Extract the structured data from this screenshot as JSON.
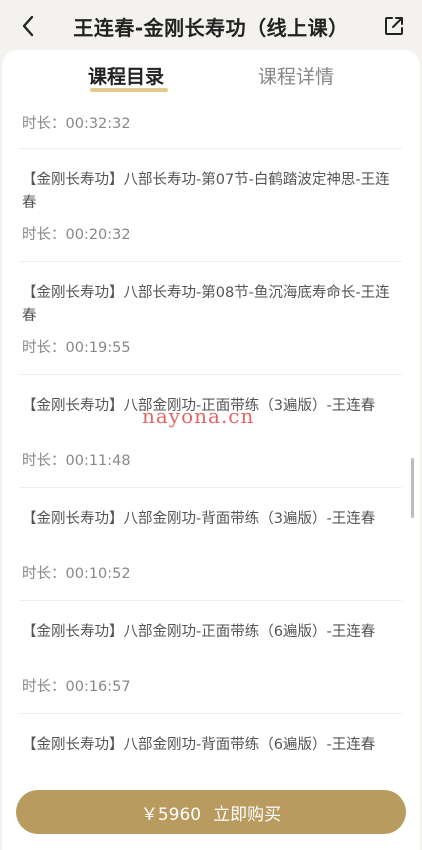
{
  "header": {
    "title": "王连春-金刚长寿功（线上课）"
  },
  "tabs": [
    {
      "label": "课程目录",
      "active": true
    },
    {
      "label": "课程详情",
      "active": false
    }
  ],
  "lessons": [
    {
      "name": "",
      "duration": "时长：00:32:32"
    },
    {
      "name": "【金刚长寿功】八部长寿功-第07节-白鹤踏波定神思-王连春",
      "duration": "时长：00:20:32"
    },
    {
      "name": "【金刚长寿功】八部长寿功-第08节-鱼沉海底寿命长-王连春",
      "duration": "时长：00:19:55"
    },
    {
      "name": "【金刚长寿功】八部金刚功-正面带练（3遍版）-王连春",
      "duration": "时长：00:11:48"
    },
    {
      "name": "【金刚长寿功】八部金刚功-背面带练（3遍版）-王连春",
      "duration": "时长：00:10:52"
    },
    {
      "name": "【金刚长寿功】八部金刚功-正面带练（6遍版）-王连春",
      "duration": "时长：00:16:57"
    },
    {
      "name": "【金刚长寿功】八部金刚功-背面带练（6遍版）-王连春",
      "duration": ""
    }
  ],
  "watermark": "nayona.cn",
  "buy": {
    "price": "￥5960",
    "label": "立即购买"
  },
  "colors": {
    "accent": "#b99a5f",
    "tab_underline": "#e4c98c",
    "watermark": "#e15656"
  }
}
